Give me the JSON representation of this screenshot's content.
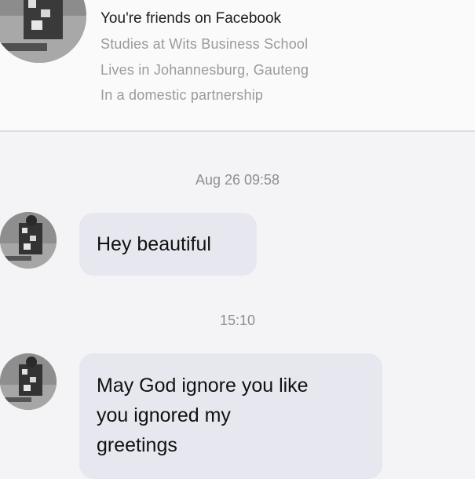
{
  "profile": {
    "title": "You're friends on Facebook",
    "studies": "Studies at Wits Business School",
    "lives": "Lives in Johannesburg, Gauteng",
    "relationship": "In a domestic partnership"
  },
  "thread": {
    "messages": [
      {
        "timestamp": "Aug 26 09:58",
        "text": "Hey beautiful"
      },
      {
        "timestamp": "15:10",
        "lines": [
          "May God ignore you like",
          "you ignored my",
          "greetings"
        ]
      }
    ]
  },
  "colors": {
    "background": "#f4f4f6",
    "bubble": "#e7e7ef",
    "secondary_text": "#9a9a9f"
  }
}
